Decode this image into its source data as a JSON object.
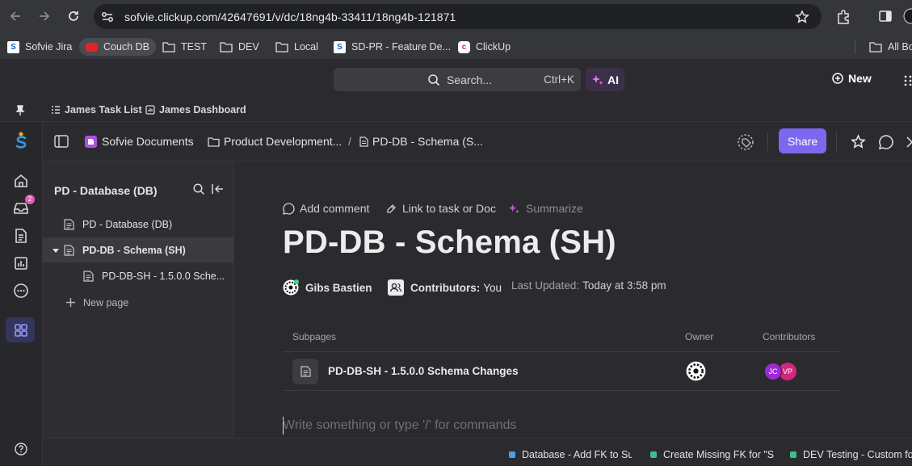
{
  "browser": {
    "url": "sofvie.clickup.com/42647691/v/dc/18ng4b-33411/18ng4b-121871"
  },
  "bookmarks": [
    {
      "label": "Sofvie Jira",
      "icon": "sofvie-favicon"
    },
    {
      "label": "Couch DB",
      "icon": "couchdb-favicon"
    },
    {
      "label": "TEST",
      "icon": "folder-icon"
    },
    {
      "label": "DEV",
      "icon": "folder-icon"
    },
    {
      "label": "Local",
      "icon": "folder-icon"
    },
    {
      "label": "SD-PR - Feature De...",
      "icon": "sofvie-favicon"
    },
    {
      "label": "ClickUp",
      "icon": "clickup-favicon"
    },
    {
      "label": "All Bo",
      "icon": "folder-icon"
    }
  ],
  "header": {
    "search_placeholder": "Search...",
    "search_shortcut": "Ctrl+K",
    "ai_label": "AI",
    "new_label": "New"
  },
  "favorites": [
    {
      "label": "James Task List",
      "icon": "list-icon"
    },
    {
      "label": "James Dashboard",
      "icon": "dashboard-icon"
    }
  ],
  "rail": {
    "inbox_badge": "2"
  },
  "breadcrumb": {
    "space": "Sofvie Documents",
    "folder": "Product Development...",
    "separator": "/",
    "doc": "PD-DB - Schema (S...",
    "share_label": "Share"
  },
  "doc_sidebar": {
    "title": "PD - Database (DB)",
    "items": [
      {
        "label": "PD - Database (DB)"
      },
      {
        "label": "PD-DB - Schema (SH)"
      },
      {
        "label": "PD-DB-SH - 1.5.0.0 Sche..."
      }
    ],
    "new_page_label": "New page"
  },
  "doc": {
    "actions": {
      "add_comment": "Add comment",
      "link": "Link to task or Doc",
      "summarize": "Summarize"
    },
    "title": "PD-DB - Schema (SH)",
    "author": "Gibs Bastien",
    "contributors_label": "Contributors:",
    "contributors_value": "You",
    "updated_label": "Last Updated:",
    "updated_value": "Today at 3:58 pm",
    "subpages_header": "Subpages",
    "owner_header": "Owner",
    "contributors_header": "Contributors",
    "subpages": [
      {
        "title": "PD-DB-SH - 1.5.0.0 Schema Changes",
        "contributors": [
          "JC",
          "VP"
        ]
      }
    ],
    "editor_placeholder": "Write something or type '/' for commands"
  },
  "bottom_tasks": [
    {
      "label": "Database - Add FK to Sub",
      "color": "#4a9fe8"
    },
    {
      "label": "Create Missing FK for \"Sul",
      "color": "#3dbf8a"
    },
    {
      "label": "DEV Testing - Custom for",
      "color": "#3dbf8a"
    }
  ],
  "colors": {
    "accent": "#7b68ee",
    "avatar_jc": "#9c2bd4",
    "avatar_vp": "#d4267a"
  }
}
